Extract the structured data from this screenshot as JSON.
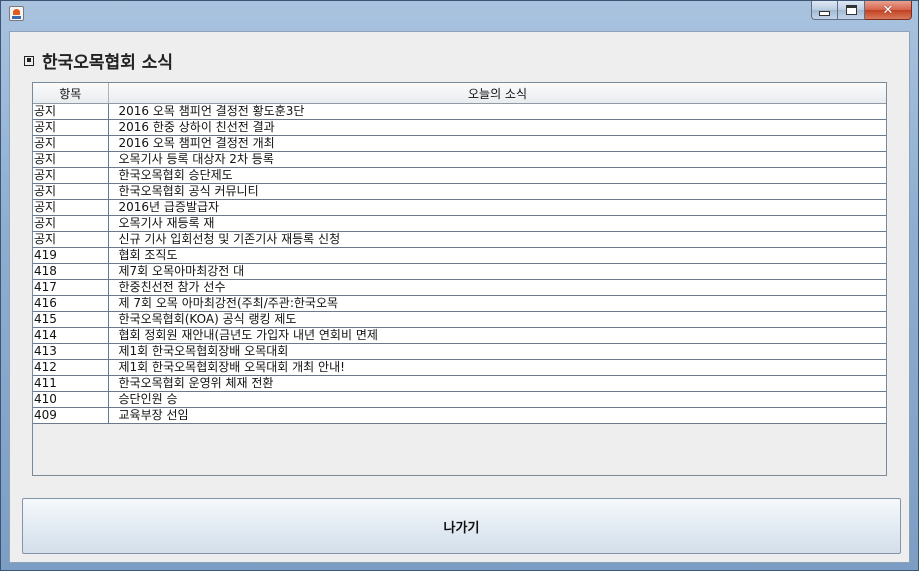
{
  "window": {
    "title": ""
  },
  "page": {
    "title": "한국오목협회 소식"
  },
  "table": {
    "headers": [
      "항목",
      "오늘의 소식"
    ],
    "rows": [
      [
        "공지",
        "2016 오목 챔피언 결정전 황도훈3단"
      ],
      [
        "공지",
        "2016 한중 상하이 친선전 결과"
      ],
      [
        "공지",
        "2016 오목 챔피언 결정전 개최"
      ],
      [
        "공지",
        "오목기사 등록 대상자 2차 등록"
      ],
      [
        "공지",
        "한국오목협회 승단제도"
      ],
      [
        "공지",
        "한국오목협회 공식 커뮤니티"
      ],
      [
        "공지",
        "2016년 급증발급자"
      ],
      [
        "공지",
        "오목기사 재등록 재"
      ],
      [
        "공지",
        "신규 기사 입회선청 및 기존기사 재등록 신청"
      ],
      [
        "419",
        "협회 조직도"
      ],
      [
        "418",
        "제7회 오목아마최강전 대"
      ],
      [
        "417",
        "한중친선전 참가 선수"
      ],
      [
        "416",
        "제 7회 오목 아마최강전(주최/주관:한국오목"
      ],
      [
        "415",
        "한국오목협회(KOA) 공식 랭킹 제도"
      ],
      [
        "414",
        "협회 정회원 재안내(금년도 가입자 내년 연회비 면제"
      ],
      [
        "413",
        "제1회 한국오목협회장배 오목대회"
      ],
      [
        "412",
        "제1회 한국오목협회장배 오목대회 개최 안내!"
      ],
      [
        "411",
        "한국오목협회 운영위 체재 전환"
      ],
      [
        "410",
        "승단인원 승"
      ],
      [
        "409",
        "교육부장 선임"
      ]
    ]
  },
  "footer": {
    "exit_label": "나가기"
  }
}
